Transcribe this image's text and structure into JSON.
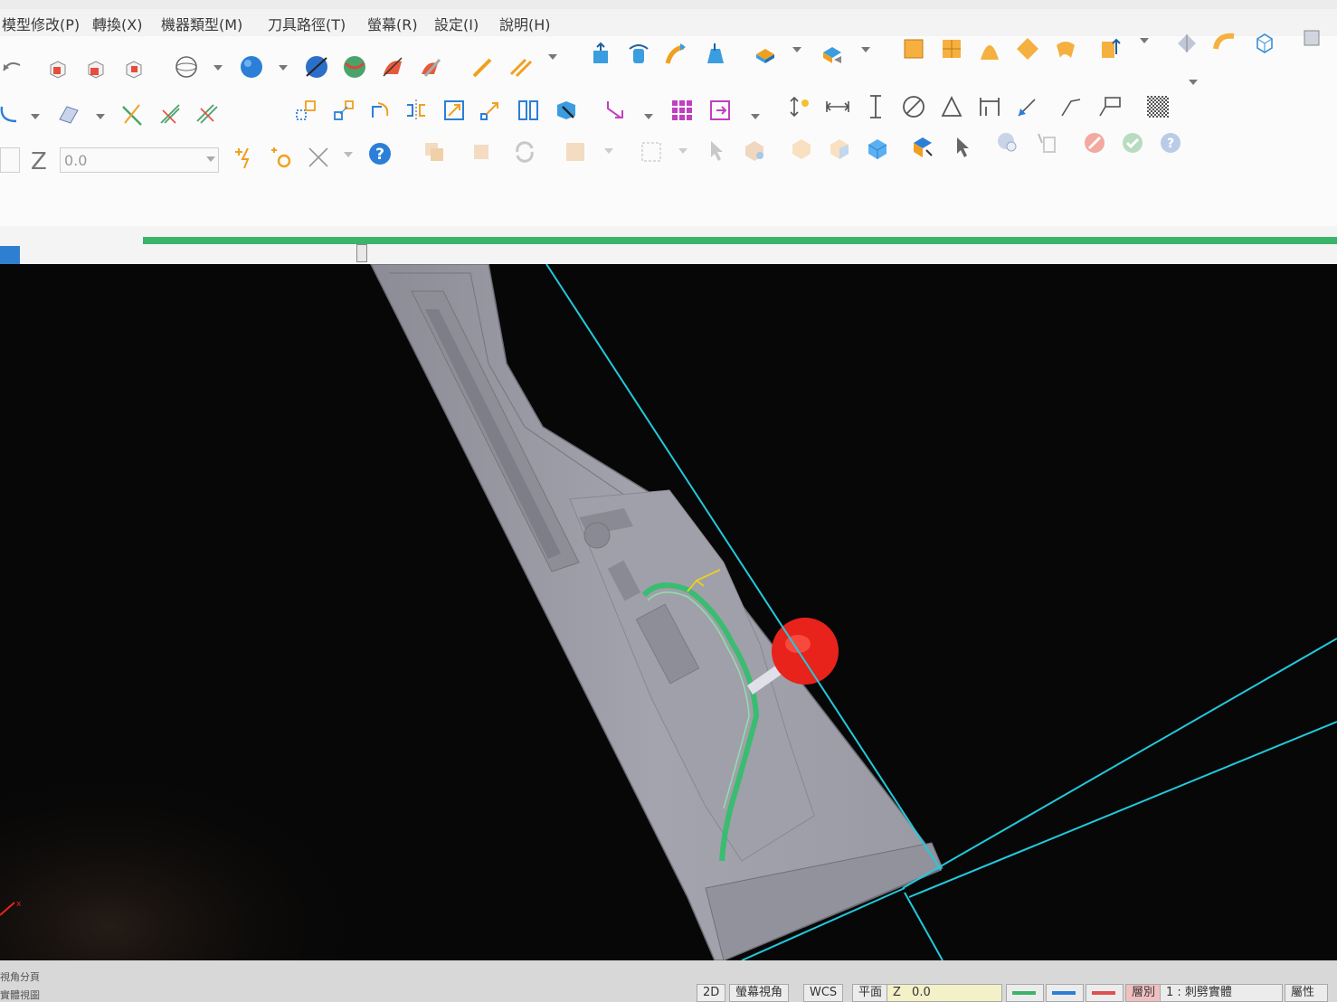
{
  "menu": {
    "items": [
      "模型修改(P)",
      "轉換(X)",
      "機器類型(M)",
      "刀具路徑(T)",
      "螢幕(R)",
      "設定(I)",
      "說明(H)"
    ]
  },
  "toolbar": {
    "z_label": "Z",
    "z_value": "0.0"
  },
  "statusbar": {
    "mode": "2D",
    "view": "螢幕視角",
    "coord": "WCS",
    "plane": "平面",
    "z_label": "Z",
    "z_value": "0.0",
    "layer_label": "層別",
    "layer_value": "1 : 刺劈實體",
    "attr_label": "屬性",
    "left_line1": "視角分頁",
    "left_line2": "實體視圖"
  },
  "colors": {
    "progress": "#3cb36a",
    "toolpath": "#2fbf6a",
    "tool": "#e8231c",
    "stock_boundary": "#22c9dc",
    "part": "#9a9aa4"
  }
}
